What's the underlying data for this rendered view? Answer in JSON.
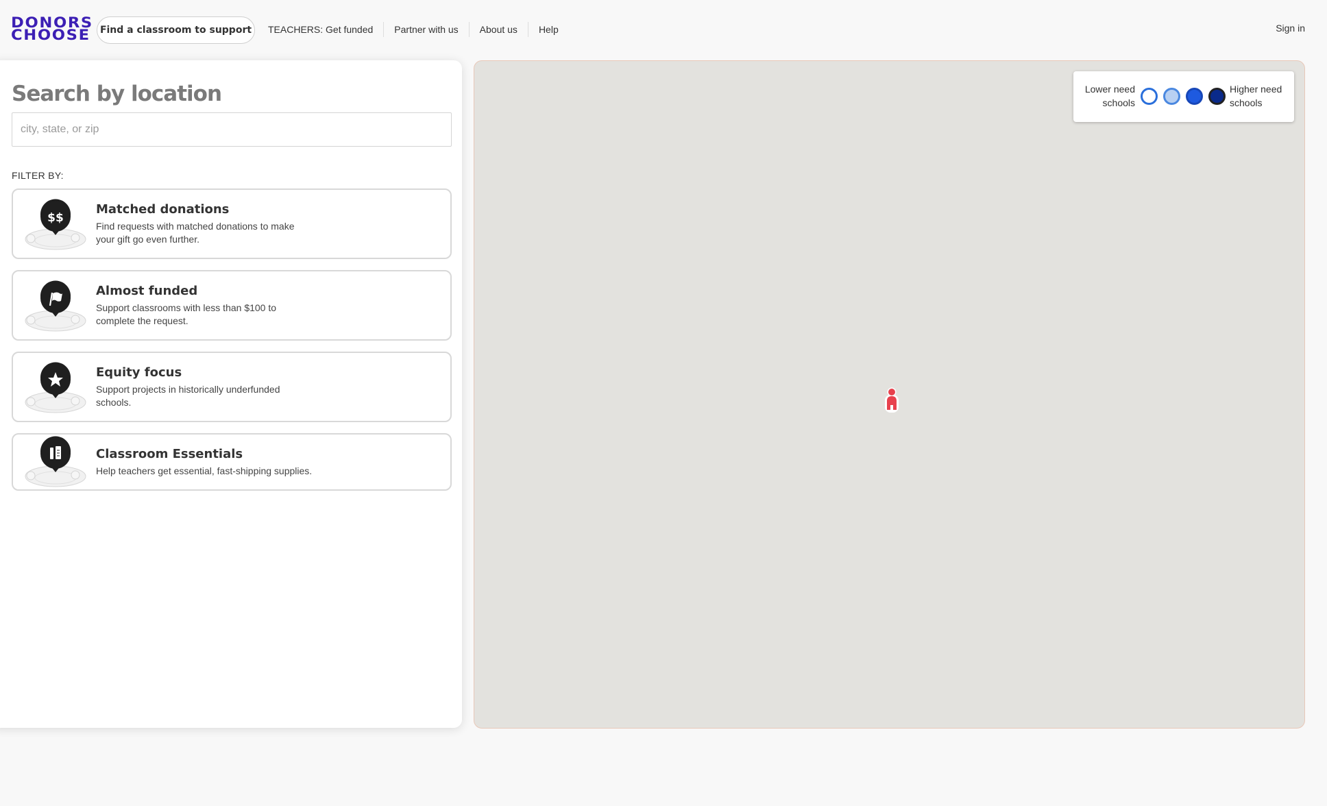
{
  "header": {
    "logo_line1": "DONORS",
    "logo_line2": "CHOOSE",
    "find_button": "Find a classroom to support",
    "nav": [
      "TEACHERS: Get funded",
      "Partner with us",
      "About us",
      "Help"
    ],
    "sign_in": "Sign in"
  },
  "search": {
    "title": "Search by location",
    "placeholder": "city, state, or zip",
    "value": ""
  },
  "filters": {
    "label": "FILTER BY:",
    "items": [
      {
        "title": "Matched donations",
        "description": "Find requests with matched donations to make your gift go even further.",
        "icon": "dollar-sign-icon",
        "glyph": "$$"
      },
      {
        "title": "Almost funded",
        "description": "Support classrooms with less than $100 to complete the request.",
        "icon": "flag-icon"
      },
      {
        "title": "Equity focus",
        "description": "Support projects in historically underfunded schools.",
        "icon": "star-icon"
      },
      {
        "title": "Classroom Essentials",
        "description": "Help teachers get essential, fast-shipping supplies.",
        "icon": "school-supplies-icon"
      }
    ]
  },
  "map": {
    "legend": {
      "low_label": "Lower need schools",
      "high_label": "Higher need schools",
      "levels": [
        {
          "fill": "#ffffff",
          "stroke": "#2a6fdb"
        },
        {
          "fill": "#b8d0f2",
          "stroke": "#4a88e0"
        },
        {
          "fill": "#1e5ae0",
          "stroke": "#1747b8"
        },
        {
          "fill": "#0a2a8a",
          "stroke": "#222222"
        }
      ]
    },
    "pin_color": "#e8414d"
  },
  "colors": {
    "brand": "#3c1fb4",
    "map_background": "#e3e2de"
  }
}
